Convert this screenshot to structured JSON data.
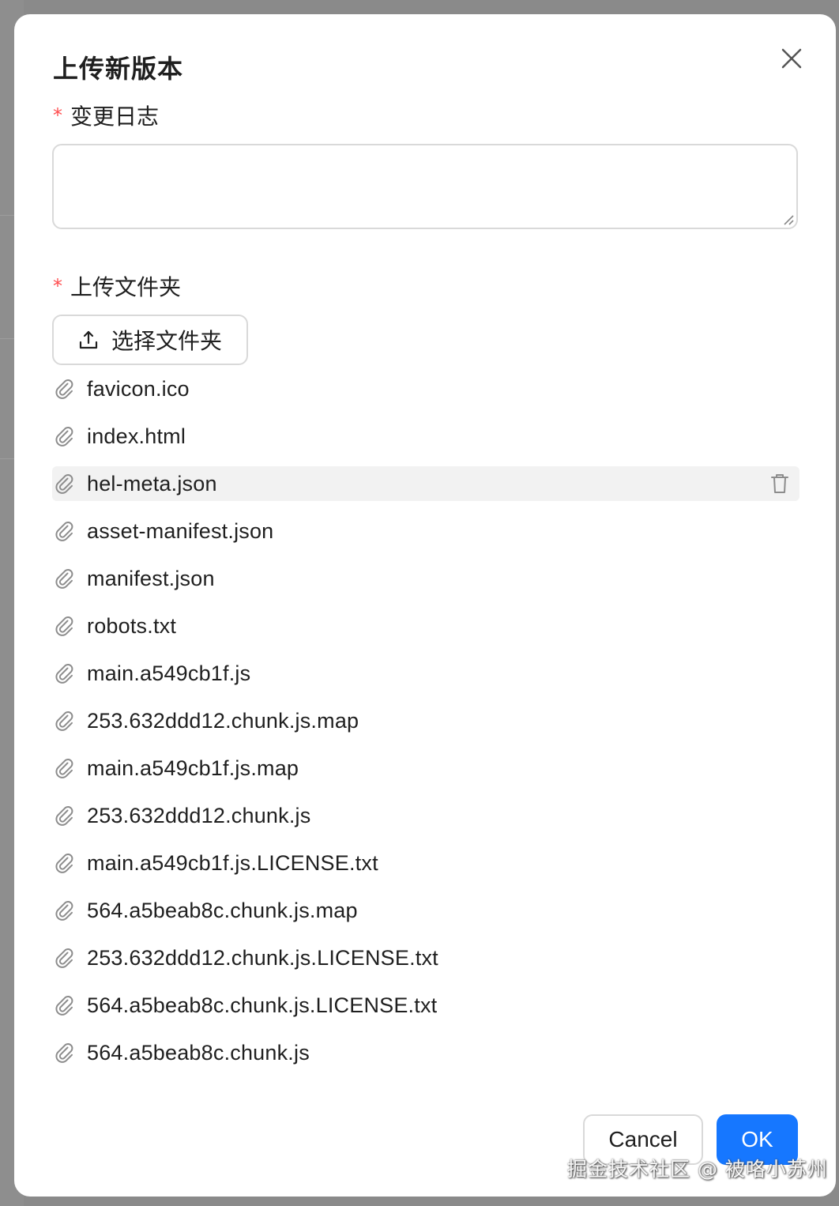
{
  "modal": {
    "title": "上传新版本",
    "changelog": {
      "required_mark": "*",
      "label": "变更日志",
      "value": "",
      "placeholder": ""
    },
    "upload": {
      "required_mark": "*",
      "label": "上传文件夹",
      "button_label": "选择文件夹"
    },
    "files": [
      "favicon.ico",
      "index.html",
      "hel-meta.json",
      "asset-manifest.json",
      "manifest.json",
      "robots.txt",
      "main.a549cb1f.js",
      "253.632ddd12.chunk.js.map",
      "main.a549cb1f.js.map",
      "253.632ddd12.chunk.js",
      "main.a549cb1f.js.LICENSE.txt",
      "564.a5beab8c.chunk.js.map",
      "253.632ddd12.chunk.js.LICENSE.txt",
      "564.a5beab8c.chunk.js.LICENSE.txt",
      "564.a5beab8c.chunk.js"
    ],
    "hovered_file_index": 2,
    "footer": {
      "cancel_label": "Cancel",
      "ok_label": "OK"
    }
  },
  "watermark": "掘金技术社区 @ 被咯小苏州",
  "colors": {
    "primary": "#1677ff",
    "required": "#ff4d4f",
    "border": "#d9d9d9",
    "hover_row": "#f2f2f2",
    "overlay": "#8a8a8a"
  },
  "icons": {
    "close": "close-icon",
    "upload": "upload-icon",
    "file": "paperclip-icon",
    "delete": "trash-icon"
  }
}
